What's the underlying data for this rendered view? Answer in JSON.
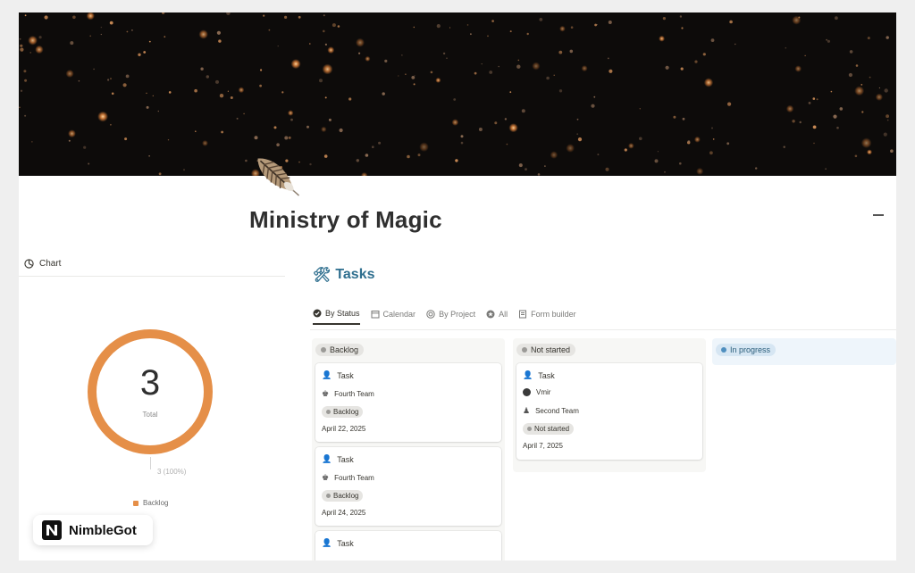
{
  "page": {
    "title": "Ministry of Magic",
    "icon": "feather-quill-icon",
    "cover": "dark-bokeh-sparks-cover"
  },
  "chart_panel": {
    "header_label": "Chart",
    "header_icon": "clock-chart-icon",
    "chart_data": {
      "type": "pie",
      "categories": [
        "Backlog"
      ],
      "values": [
        3
      ],
      "center_value": "3",
      "center_label": "Total",
      "data_labels": [
        "3 (100%)"
      ],
      "legend": [
        "Backlog"
      ],
      "legend_position": "bottom",
      "colors": [
        "#e58f48"
      ]
    }
  },
  "tasks": {
    "title": "Tasks",
    "title_icon": "hammer-wrench-icon",
    "title_color": "#2f6f8f",
    "views": [
      {
        "label": "By Status",
        "icon": "check-circle-icon",
        "active": true
      },
      {
        "label": "Calendar",
        "icon": "calendar-icon",
        "active": false
      },
      {
        "label": "By Project",
        "icon": "target-icon",
        "active": false
      },
      {
        "label": "All",
        "icon": "star-circle-icon",
        "active": false
      },
      {
        "label": "Form builder",
        "icon": "form-icon",
        "active": false
      }
    ],
    "columns": [
      {
        "label": "Backlog",
        "color": "#9b9a97",
        "cards": [
          {
            "name": "Task",
            "team": "Fourth Team",
            "status": "Backlog",
            "date": "April 22, 2025"
          },
          {
            "name": "Task",
            "team": "Fourth Team",
            "status": "Backlog",
            "date": "April 24, 2025"
          },
          {
            "name": "Task"
          }
        ]
      },
      {
        "label": "Not started",
        "color": "#9b9a97",
        "cards": [
          {
            "name": "Task",
            "assignee": "Vmir",
            "team": "Second Team",
            "status": "Not started",
            "date": "April 7, 2025"
          }
        ]
      },
      {
        "label": "In progress",
        "color": "#4f8fbf",
        "cards": []
      }
    ]
  },
  "brand": {
    "name": "NimbleGot",
    "logo": "n-logo-icon"
  }
}
